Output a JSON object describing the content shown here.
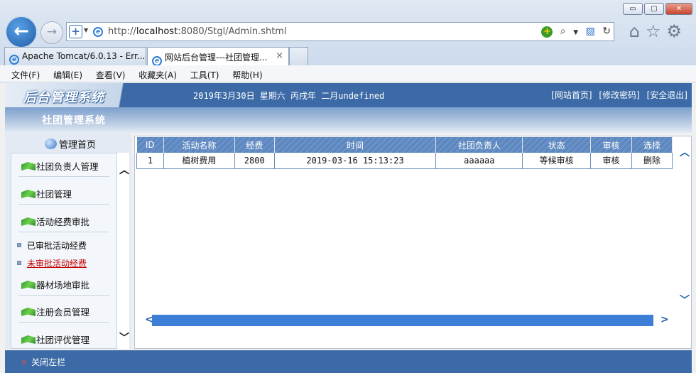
{
  "browser": {
    "url_prefix": "http://",
    "url_host": "localhost",
    "url_rest": ":8080/Stgl/Admin.shtml",
    "tabs": [
      {
        "label": "Apache Tomcat/6.0.13 - Err..."
      },
      {
        "label": "网站后台管理---社团管理...",
        "close": "×"
      }
    ],
    "menu": [
      "文件(F)",
      "编辑(E)",
      "查看(V)",
      "收藏夹(A)",
      "工具(T)",
      "帮助(H)"
    ],
    "window_buttons": {
      "minimize": "▭",
      "maximize": "▢",
      "close": "✕"
    }
  },
  "header": {
    "logo": "后台管理系统",
    "date": "2019年3月30日 星期六 丙戌年 二月undefined",
    "links": [
      "[网站首页]",
      "[修改密码]",
      "[安全退出]"
    ],
    "subtitle": "社团管理系统"
  },
  "sidebar": {
    "home": "管理首页",
    "items": [
      {
        "label": "社团负责人管理"
      },
      {
        "label": "社团管理"
      },
      {
        "label": "活动经费审批"
      },
      {
        "label": "器材场地审批"
      },
      {
        "label": "注册会员管理"
      },
      {
        "label": "社团评优管理"
      }
    ],
    "subitems": [
      {
        "label": "已审批活动经费"
      },
      {
        "label": "未审批活动经费"
      }
    ]
  },
  "table": {
    "columns": [
      "ID",
      "活动名称",
      "经费",
      "时间",
      "社团负责人",
      "状态",
      "审核",
      "选择"
    ],
    "rows": [
      {
        "id": "1",
        "name": "植树费用",
        "fee": "2800",
        "time": "2019-03-16 15:13:23",
        "leader": "aaaaaa",
        "status": "等候审核",
        "review": "审核",
        "select": "删除"
      }
    ]
  },
  "footer": {
    "close_sidebar": "关闭左栏",
    "close_icon": "×"
  },
  "colors": {
    "primary": "#3c6aa6",
    "header_grid": "#5c86bd",
    "scroll_track": "#3d7fd6",
    "active_link": "#c40000"
  }
}
